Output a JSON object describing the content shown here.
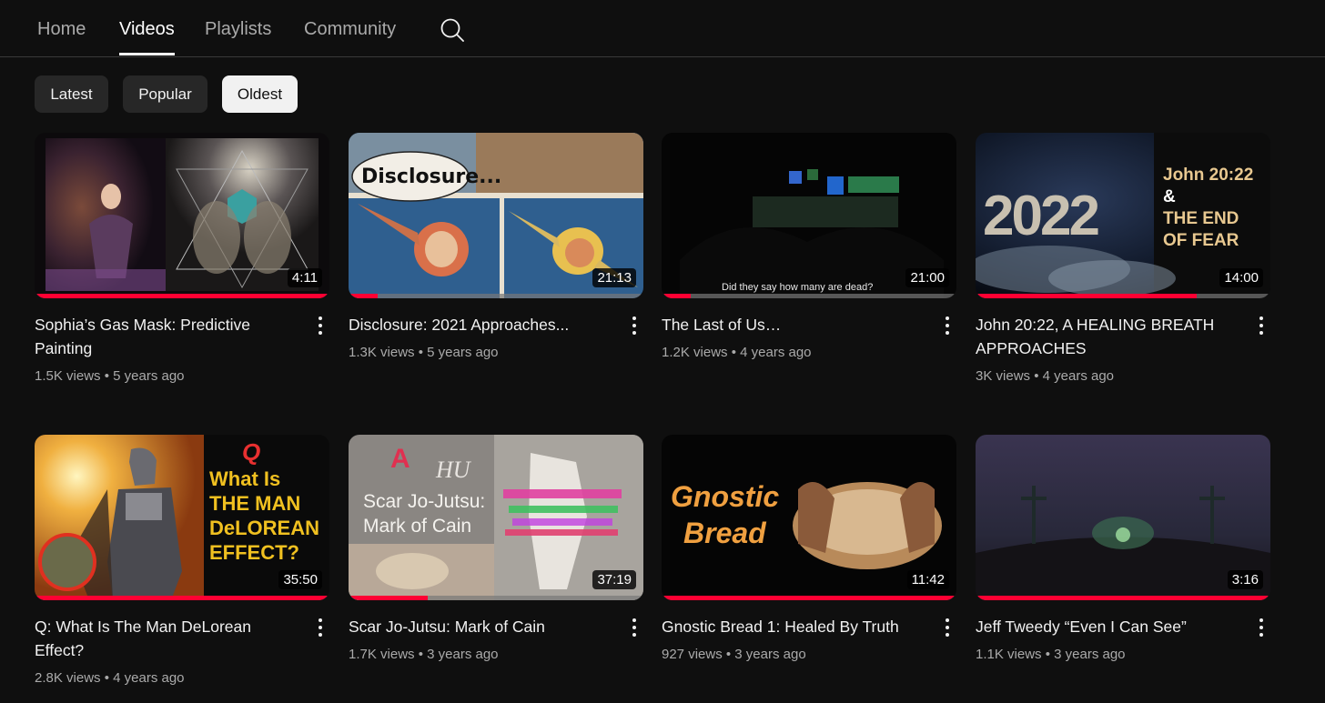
{
  "tabs": [
    {
      "label": "Home",
      "active": false
    },
    {
      "label": "Videos",
      "active": true
    },
    {
      "label": "Playlists",
      "active": false
    },
    {
      "label": "Community",
      "active": false
    }
  ],
  "search": {
    "icon": "search-icon"
  },
  "chips": [
    {
      "label": "Latest",
      "selected": false
    },
    {
      "label": "Popular",
      "selected": false
    },
    {
      "label": "Oldest",
      "selected": true
    }
  ],
  "videos": [
    {
      "title": "Sophia’s Gas Mask: Predictive Painting",
      "views": "1.5K views",
      "age": "5 years ago",
      "duration": "4:11",
      "watched": 1.0
    },
    {
      "title": "Disclosure: 2021 Approaches...",
      "views": "1.3K views",
      "age": "5 years ago",
      "duration": "21:13",
      "watched": 0.1,
      "thumb_text": "Disclosure..."
    },
    {
      "title": "The Last of Us…",
      "views": "1.2K views",
      "age": "4 years ago",
      "duration": "21:00",
      "watched": 0.1,
      "thumb_text": "Did they say how many are dead?"
    },
    {
      "title": "John 20:22, A HEALING BREATH APPROACHES",
      "views": "3K views",
      "age": "4 years ago",
      "duration": "14:00",
      "watched": 0.75,
      "thumb_text": {
        "year": "2022",
        "line1": "John 20:22",
        "line2": "&",
        "line3": "THE END",
        "line4": "OF FEAR"
      }
    },
    {
      "title": "Q: What Is The Man DeLorean Effect?",
      "views": "2.8K views",
      "age": "4 years ago",
      "duration": "35:50",
      "watched": 1.0,
      "thumb_text": {
        "q": "Q",
        "line1": "What Is",
        "line2": "THE MAN",
        "line3": "DeLOREAN",
        "line4": "EFFECT?"
      }
    },
    {
      "title": "Scar Jo-Jutsu: Mark of Cain",
      "views": "1.7K views",
      "age": "3 years ago",
      "duration": "37:19",
      "watched": 0.27,
      "thumb_text": {
        "a": "A",
        "hu": "HU",
        "line1": "Scar Jo-Jutsu:",
        "line2": "Mark of Cain"
      }
    },
    {
      "title": "Gnostic Bread 1: Healed By Truth",
      "views": "927 views",
      "age": "3 years ago",
      "duration": "11:42",
      "watched": 1.0,
      "thumb_text": {
        "line1": "Gnostic",
        "line2": "Bread"
      }
    },
    {
      "title": "Jeff Tweedy “Even I Can See”",
      "views": "1.1K views",
      "age": "3 years ago",
      "duration": "3:16",
      "watched": 1.0
    }
  ],
  "colors": {
    "background": "#0f0f0f",
    "progress": "#ff0033",
    "chip": "#272727",
    "chip_selected": "#f1f1f1"
  }
}
